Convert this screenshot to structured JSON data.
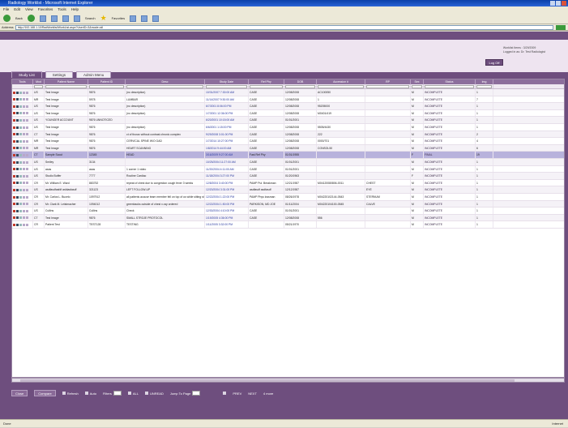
{
  "window": {
    "title": "Radiology Worklist - Microsoft Internet Explorer"
  },
  "menu": [
    "File",
    "Edit",
    "View",
    "Favorites",
    "Tools",
    "Help"
  ],
  "toolbar": {
    "back_label": "Back",
    "search_label": "Search",
    "favorites_label": "Favorites"
  },
  "address": {
    "label": "Address",
    "url": "http://192.168.1.10/RadWorklist/WorkList.aspx?UserID=3&mode=all"
  },
  "header": {
    "info_line1": "Worklist Items : 3/29/2009",
    "info_line2": "Logged in as: Dr. Test Radiologist",
    "logoff_label": "Log Off"
  },
  "tabs": [
    {
      "label": "Study List",
      "active": true
    },
    {
      "label": "Settings",
      "active": false
    },
    {
      "label": "Admin Menu",
      "active": false
    }
  ],
  "columns": [
    "Tools",
    "Mod",
    "Patient Name",
    "Patient ID",
    "Desc",
    "Study Date",
    "Ref Phy",
    "DOB",
    "Accession #",
    "RP",
    "Sex",
    "Status",
    "Img"
  ],
  "rows": [
    {
      "tools": "",
      "mod": "US",
      "name": "Test Image",
      "pid": "9876",
      "desc": "(no description)",
      "date": "10/31/2007 7:30:00 AM",
      "ref": "CASE",
      "dob": "12/08/2008",
      "acc": "AC100050",
      "rp": "",
      "sex": "M",
      "status": "INCOMPLETE",
      "img": "1"
    },
    {
      "tools": "",
      "mod": "MR",
      "name": "Test Image",
      "pid": "5978",
      "desc": "LUMBAR",
      "date": "11/14/2007 9:30:00 AM",
      "ref": "CASE",
      "dob": "12/08/2008",
      "acc": "1",
      "rp": "",
      "sex": "M",
      "status": "INCOMPLETE",
      "img": "7"
    },
    {
      "tools": "",
      "mod": "US",
      "name": "Test Image",
      "pid": "9876",
      "desc": "(no description)",
      "date": "6/7/2001 8:06:00 PM",
      "ref": "CASE",
      "dob": "12/08/2008",
      "acc": "95205000",
      "rp": "",
      "sex": "M",
      "status": "INCOMPLETE",
      "img": "1"
    },
    {
      "tools": "",
      "mod": "US",
      "name": "Test Image",
      "pid": "9876",
      "desc": "(no description)",
      "date": "1/7/2001 12:36:00 PM",
      "ref": "CASE",
      "dob": "12/08/2008",
      "acc": "M0401/419",
      "rp": "",
      "sex": "M",
      "status": "INCOMPLETE",
      "img": "1"
    },
    {
      "tools": "",
      "mod": "US",
      "name": "YOUNGER ACCOUNT",
      "pid": "9876 UNNOTICED",
      "desc": "",
      "date": "6/20/2001 10:15:00 AM",
      "ref": "CASE",
      "dob": "01/01/2001",
      "acc": "",
      "rp": "",
      "sex": "M",
      "status": "INCOMPLETE",
      "img": "1"
    },
    {
      "tools": "",
      "mod": "US",
      "name": "Test Image",
      "pid": "9876",
      "desc": "(no description)",
      "date": "6/6/2001 1:15:00 PM",
      "ref": "CASE",
      "dob": "12/08/2008",
      "acc": "5505/4430",
      "rp": "",
      "sex": "M",
      "status": "INCOMPLETE",
      "img": "1"
    },
    {
      "tools": "",
      "mod": "CT",
      "name": "Test Image",
      "pid": "9876",
      "desc": "ct of thorax without contrast chronic complex",
      "date": "9/29/2008 3:01:00 PM",
      "ref": "CASE",
      "dob": "12/08/2008",
      "acc": "222",
      "rp": "",
      "sex": "M",
      "status": "INCOMPLETE",
      "img": "2"
    },
    {
      "tools": "",
      "mod": "MR",
      "name": "Test Image",
      "pid": "9876",
      "desc": "CERVICAL SPINE W/O GAD",
      "date": "1/7/2014 10:27:00 PM",
      "ref": "CASE",
      "dob": "12/08/2008",
      "acc": "0000/701",
      "rp": "",
      "sex": "M",
      "status": "INCOMPLETE",
      "img": "4"
    },
    {
      "tools": "",
      "mod": "MR",
      "name": "Test Image",
      "pid": "9876",
      "desc": "HEART SCANNING",
      "date": "1/8/2014 9:44:00 AM",
      "ref": "CASE",
      "dob": "12/08/2008",
      "acc": "CONSOL50",
      "rp": "",
      "sex": "M",
      "status": "INCOMPLETE",
      "img": "6"
    },
    {
      "tools": "",
      "mod": "CT",
      "name": "Sample Scout",
      "pid": "12345",
      "desc": "HEAD",
      "date": "3/16/2009 9:27:00 AM",
      "ref": "Fast Ref Phy",
      "dob": "01/01/1955",
      "acc": "",
      "rp": "",
      "sex": "F",
      "status": "FINAL",
      "img": "19",
      "sel": true
    },
    {
      "tools": "",
      "mod": "US",
      "name": "Smiley",
      "pid": "3134",
      "desc": "",
      "date": "10/25/2004 11:27:00 AM",
      "ref": "CASE",
      "dob": "01/01/2001",
      "acc": "",
      "rp": "",
      "sex": "M",
      "status": "INCOMPLETE",
      "img": "1"
    },
    {
      "tools": "",
      "mod": "US",
      "name": "asas",
      "pid": "asas",
      "desc": "1 corner 1 video",
      "date": "11/20/2004 4:11:00 AM",
      "ref": "CASE",
      "dob": "01/01/2001",
      "acc": "",
      "rp": "",
      "sex": "M",
      "status": "INCOMPLETE",
      "img": "1"
    },
    {
      "tools": "",
      "mod": "US",
      "name": "Studio Buffer",
      "pid": "7777",
      "desc": "Routine Cardiac",
      "date": "11/18/2004 3:27:00 PM",
      "ref": "CASE",
      "dob": "01/20/1963",
      "acc": "",
      "rp": "",
      "sex": "F",
      "status": "INCOMPLETE",
      "img": "1"
    },
    {
      "tools": "",
      "mod": "CR",
      "name": "Mr. William E. Ward",
      "pid": "883752",
      "desc": "repeat of chest due to congestion cough fever 3 weeks",
      "date": "12/8/2004 3:40:00 PM",
      "ref": "PAMP Pul. Breakman",
      "dob": "12/21/1987",
      "acc": "M04120080806-0011",
      "rp": "CHEST",
      "sex": "M",
      "status": "INCOMPLETE",
      "img": "1"
    },
    {
      "tools": "",
      "mod": "US",
      "name": "asdfasdfasfdf asfdasfasdf",
      "pid": "321123",
      "desc": "LEFT FOLLOW-UP",
      "date": "12/20/2004 3:31:00 PM",
      "ref": "asdfasdf asdfasdf",
      "dob": "12/12/1987",
      "acc": "",
      "rp": "EYE",
      "sex": "M",
      "status": "INCOMPLETE",
      "img": "1"
    },
    {
      "tools": "",
      "mod": "CR",
      "name": "Mr. Carlos L. Bucelo",
      "pid": "1097912",
      "desc": "all patients accuse team member fell on top of us while sitting still",
      "date": "12/22/2004 1:22:00 PM",
      "ref": "PAMP Phys lossman",
      "dob": "08/26/1978",
      "acc": "M04220102144-0543",
      "rp": "STERNUM",
      "sex": "M",
      "status": "INCOMPLETE",
      "img": "1"
    },
    {
      "tools": "",
      "mod": "CR",
      "name": "Mr. Clark M. Leistmacher",
      "pid": "1094012",
      "desc": "greenbacks outside of chest x-ray ordered",
      "date": "12/22/2004 1:50:00 PM",
      "ref": "PARKISON, MD JOE",
      "dob": "01/11/2004",
      "acc": "M04220104100-0545",
      "rp": "CALVE",
      "sex": "M",
      "status": "INCOMPLETE",
      "img": "1"
    },
    {
      "tools": "",
      "mod": "US",
      "name": "Cullins",
      "pid": "Cullins",
      "desc": "Check",
      "date": "12/30/2004 4:10:00 PM",
      "ref": "CASE",
      "dob": "01/01/2001",
      "acc": "",
      "rp": "",
      "sex": "M",
      "status": "INCOMPLETE",
      "img": "1"
    },
    {
      "tools": "",
      "mod": "CT",
      "name": "Test Image",
      "pid": "9876",
      "desc": "SMALL STROJE PROTOCOL",
      "date": "1/19/2005 4:36:00 PM",
      "ref": "CASE",
      "dob": "12/08/2008",
      "acc": "556",
      "rp": "",
      "sex": "M",
      "status": "INCOMPLETE",
      "img": "1"
    },
    {
      "tools": "",
      "mod": "CR",
      "name": "Patient Test",
      "pid": "TEST128",
      "desc": "TESTING",
      "date": "1/11/2005 3:32:00 PM",
      "ref": "",
      "dob": "05/21/1970",
      "acc": "",
      "rp": "",
      "sex": "M",
      "status": "INCOMPLETE",
      "img": "1"
    }
  ],
  "bottombar": {
    "close_label": "Close",
    "compare_label": "Compare",
    "refresh_label": "Refresh",
    "auto_label": "Auto",
    "filters_label": "Filters",
    "all_label": "ALL",
    "unread_label": "UNREAD",
    "jump_label": "Jump To Page",
    "prev_label": "PREV",
    "next_label": "NEXT",
    "records_label": "4 more"
  },
  "statusbar": {
    "left": "Done",
    "right": "Internet"
  }
}
